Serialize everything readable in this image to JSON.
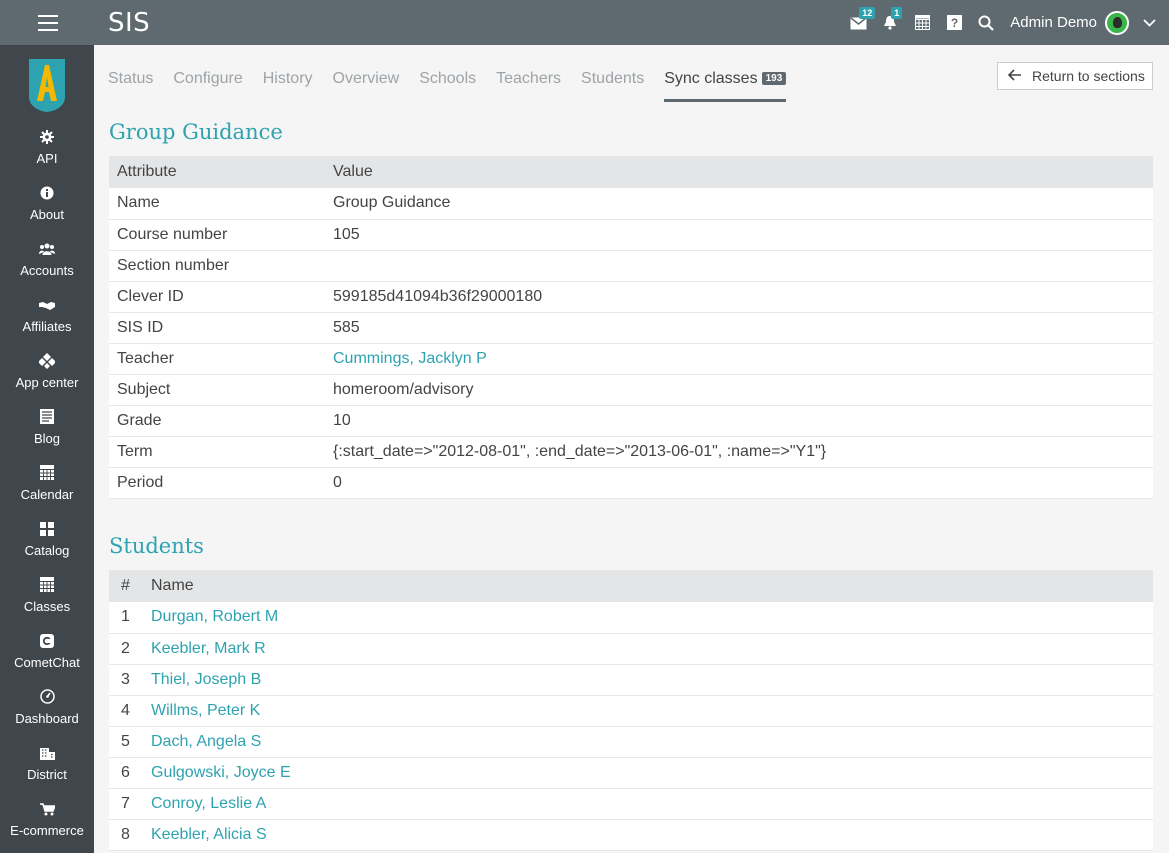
{
  "header": {
    "title": "SIS",
    "mail_badge": "12",
    "notif_badge": "1",
    "user": "Admin Demo"
  },
  "sidebar": {
    "items": [
      {
        "label": "API",
        "icon": "gear-icon"
      },
      {
        "label": "About",
        "icon": "info-icon"
      },
      {
        "label": "Accounts",
        "icon": "users-icon"
      },
      {
        "label": "Affiliates",
        "icon": "handshake-icon"
      },
      {
        "label": "App center",
        "icon": "apps-icon"
      },
      {
        "label": "Blog",
        "icon": "blog-icon"
      },
      {
        "label": "Calendar",
        "icon": "calendar-icon"
      },
      {
        "label": "Catalog",
        "icon": "catalog-icon"
      },
      {
        "label": "Classes",
        "icon": "classes-icon"
      },
      {
        "label": "CometChat",
        "icon": "chat-icon"
      },
      {
        "label": "Dashboard",
        "icon": "dashboard-icon"
      },
      {
        "label": "District",
        "icon": "building-icon"
      },
      {
        "label": "E-commerce",
        "icon": "cart-icon"
      }
    ]
  },
  "tabs": [
    {
      "label": "Status"
    },
    {
      "label": "Configure"
    },
    {
      "label": "History"
    },
    {
      "label": "Overview"
    },
    {
      "label": "Schools"
    },
    {
      "label": "Teachers"
    },
    {
      "label": "Students"
    },
    {
      "label": "Sync classes",
      "count": "193"
    }
  ],
  "return_button": "Return to sections",
  "class_info": {
    "title": "Group Guidance",
    "headers": [
      "Attribute",
      "Value"
    ],
    "rows": [
      {
        "attr": "Name",
        "value": "Group Guidance"
      },
      {
        "attr": "Course number",
        "value": "105"
      },
      {
        "attr": "Section number",
        "value": ""
      },
      {
        "attr": "Clever ID",
        "value": "599185d41094b36f29000180"
      },
      {
        "attr": "SIS ID",
        "value": "585"
      },
      {
        "attr": "Teacher",
        "value": "Cummings, Jacklyn P"
      },
      {
        "attr": "Subject",
        "value": "homeroom/advisory"
      },
      {
        "attr": "Grade",
        "value": "10"
      },
      {
        "attr": "Term",
        "value": "{:start_date=>\"2012-08-01\", :end_date=>\"2013-06-01\", :name=>\"Y1\"}"
      },
      {
        "attr": "Period",
        "value": "0"
      }
    ]
  },
  "students": {
    "title": "Students",
    "headers": [
      "#",
      "Name"
    ],
    "rows": [
      {
        "num": "1",
        "name": "Durgan, Robert M"
      },
      {
        "num": "2",
        "name": "Keebler, Mark R"
      },
      {
        "num": "3",
        "name": "Thiel, Joseph B"
      },
      {
        "num": "4",
        "name": "Willms, Peter K"
      },
      {
        "num": "5",
        "name": "Dach, Angela S"
      },
      {
        "num": "6",
        "name": "Gulgowski, Joyce E"
      },
      {
        "num": "7",
        "name": "Conroy, Leslie A"
      },
      {
        "num": "8",
        "name": "Keebler, Alicia S"
      }
    ]
  },
  "colors": {
    "accent": "#2ea3b0",
    "topbar": "#5f6970",
    "sidebar": "#3f474d"
  }
}
